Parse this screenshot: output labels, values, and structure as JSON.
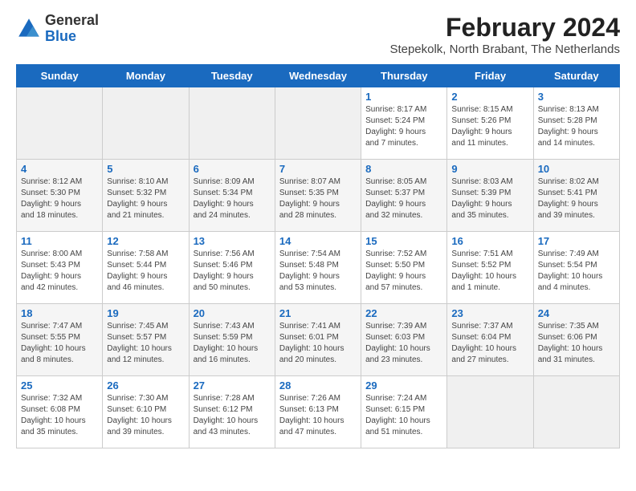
{
  "header": {
    "logo_line1": "General",
    "logo_line2": "Blue",
    "month_year": "February 2024",
    "location": "Stepekolk, North Brabant, The Netherlands"
  },
  "weekdays": [
    "Sunday",
    "Monday",
    "Tuesday",
    "Wednesday",
    "Thursday",
    "Friday",
    "Saturday"
  ],
  "weeks": [
    [
      {
        "day": "",
        "info": ""
      },
      {
        "day": "",
        "info": ""
      },
      {
        "day": "",
        "info": ""
      },
      {
        "day": "",
        "info": ""
      },
      {
        "day": "1",
        "info": "Sunrise: 8:17 AM\nSunset: 5:24 PM\nDaylight: 9 hours\nand 7 minutes."
      },
      {
        "day": "2",
        "info": "Sunrise: 8:15 AM\nSunset: 5:26 PM\nDaylight: 9 hours\nand 11 minutes."
      },
      {
        "day": "3",
        "info": "Sunrise: 8:13 AM\nSunset: 5:28 PM\nDaylight: 9 hours\nand 14 minutes."
      }
    ],
    [
      {
        "day": "4",
        "info": "Sunrise: 8:12 AM\nSunset: 5:30 PM\nDaylight: 9 hours\nand 18 minutes."
      },
      {
        "day": "5",
        "info": "Sunrise: 8:10 AM\nSunset: 5:32 PM\nDaylight: 9 hours\nand 21 minutes."
      },
      {
        "day": "6",
        "info": "Sunrise: 8:09 AM\nSunset: 5:34 PM\nDaylight: 9 hours\nand 24 minutes."
      },
      {
        "day": "7",
        "info": "Sunrise: 8:07 AM\nSunset: 5:35 PM\nDaylight: 9 hours\nand 28 minutes."
      },
      {
        "day": "8",
        "info": "Sunrise: 8:05 AM\nSunset: 5:37 PM\nDaylight: 9 hours\nand 32 minutes."
      },
      {
        "day": "9",
        "info": "Sunrise: 8:03 AM\nSunset: 5:39 PM\nDaylight: 9 hours\nand 35 minutes."
      },
      {
        "day": "10",
        "info": "Sunrise: 8:02 AM\nSunset: 5:41 PM\nDaylight: 9 hours\nand 39 minutes."
      }
    ],
    [
      {
        "day": "11",
        "info": "Sunrise: 8:00 AM\nSunset: 5:43 PM\nDaylight: 9 hours\nand 42 minutes."
      },
      {
        "day": "12",
        "info": "Sunrise: 7:58 AM\nSunset: 5:44 PM\nDaylight: 9 hours\nand 46 minutes."
      },
      {
        "day": "13",
        "info": "Sunrise: 7:56 AM\nSunset: 5:46 PM\nDaylight: 9 hours\nand 50 minutes."
      },
      {
        "day": "14",
        "info": "Sunrise: 7:54 AM\nSunset: 5:48 PM\nDaylight: 9 hours\nand 53 minutes."
      },
      {
        "day": "15",
        "info": "Sunrise: 7:52 AM\nSunset: 5:50 PM\nDaylight: 9 hours\nand 57 minutes."
      },
      {
        "day": "16",
        "info": "Sunrise: 7:51 AM\nSunset: 5:52 PM\nDaylight: 10 hours\nand 1 minute."
      },
      {
        "day": "17",
        "info": "Sunrise: 7:49 AM\nSunset: 5:54 PM\nDaylight: 10 hours\nand 4 minutes."
      }
    ],
    [
      {
        "day": "18",
        "info": "Sunrise: 7:47 AM\nSunset: 5:55 PM\nDaylight: 10 hours\nand 8 minutes."
      },
      {
        "day": "19",
        "info": "Sunrise: 7:45 AM\nSunset: 5:57 PM\nDaylight: 10 hours\nand 12 minutes."
      },
      {
        "day": "20",
        "info": "Sunrise: 7:43 AM\nSunset: 5:59 PM\nDaylight: 10 hours\nand 16 minutes."
      },
      {
        "day": "21",
        "info": "Sunrise: 7:41 AM\nSunset: 6:01 PM\nDaylight: 10 hours\nand 20 minutes."
      },
      {
        "day": "22",
        "info": "Sunrise: 7:39 AM\nSunset: 6:03 PM\nDaylight: 10 hours\nand 23 minutes."
      },
      {
        "day": "23",
        "info": "Sunrise: 7:37 AM\nSunset: 6:04 PM\nDaylight: 10 hours\nand 27 minutes."
      },
      {
        "day": "24",
        "info": "Sunrise: 7:35 AM\nSunset: 6:06 PM\nDaylight: 10 hours\nand 31 minutes."
      }
    ],
    [
      {
        "day": "25",
        "info": "Sunrise: 7:32 AM\nSunset: 6:08 PM\nDaylight: 10 hours\nand 35 minutes."
      },
      {
        "day": "26",
        "info": "Sunrise: 7:30 AM\nSunset: 6:10 PM\nDaylight: 10 hours\nand 39 minutes."
      },
      {
        "day": "27",
        "info": "Sunrise: 7:28 AM\nSunset: 6:12 PM\nDaylight: 10 hours\nand 43 minutes."
      },
      {
        "day": "28",
        "info": "Sunrise: 7:26 AM\nSunset: 6:13 PM\nDaylight: 10 hours\nand 47 minutes."
      },
      {
        "day": "29",
        "info": "Sunrise: 7:24 AM\nSunset: 6:15 PM\nDaylight: 10 hours\nand 51 minutes."
      },
      {
        "day": "",
        "info": ""
      },
      {
        "day": "",
        "info": ""
      }
    ]
  ]
}
